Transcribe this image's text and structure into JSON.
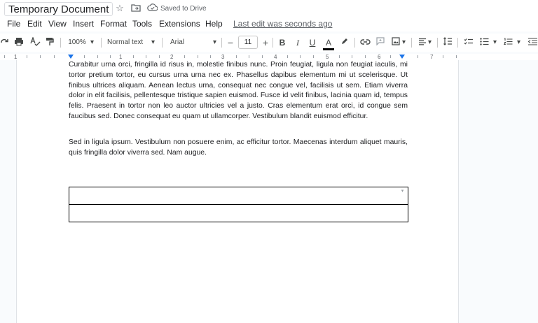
{
  "title": {
    "doc_name": "Temporary Document",
    "saved_status": "Saved to Drive"
  },
  "menu": {
    "items": [
      "File",
      "Edit",
      "View",
      "Insert",
      "Format",
      "Tools",
      "Extensions",
      "Help"
    ],
    "last_edit": "Last edit was seconds ago"
  },
  "toolbar": {
    "zoom": "100%",
    "style": "Normal text",
    "font": "Arial",
    "font_size": "11",
    "minus": "−",
    "plus": "+",
    "bold": "B",
    "italic": "I",
    "underline": "U",
    "text_color": "A"
  },
  "ruler": {
    "labels": [
      "1",
      "1",
      "2",
      "3",
      "4",
      "5",
      "6",
      "7"
    ]
  },
  "document": {
    "paragraphs": [
      "Curabitur urna orci, fringilla id risus in, molestie finibus nunc. Proin feugiat, ligula non feugiat iaculis, mi tortor pretium tortor, eu cursus urna urna nec ex. Phasellus dapibus elementum mi ut scelerisque. Ut finibus ultrices aliquam. Aenean lectus urna, consequat nec congue vel, facilisis ut sem. Etiam viverra dolor in elit facilisis, pellentesque tristique sapien euismod. Fusce id velit finibus, lacinia quam id, tempus felis. Praesent in tortor non leo auctor ultricies vel a justo. Cras  elementum erat orci, id congue sem faucibus sed. Donec consequat eu quam ut ullamcorper. Vestibulum blandit euismod efficitur.",
      "Sed in ligula ipsum. Vestibulum non posuere enim, ac efficitur tortor. Maecenas interdum aliquet mauris, quis fringilla dolor viverra sed. Nam augue."
    ],
    "table_rows": 2
  },
  "colors": {
    "accent": "#1a73e8",
    "page_bg": "#f9fbfd",
    "text": "#202124"
  }
}
